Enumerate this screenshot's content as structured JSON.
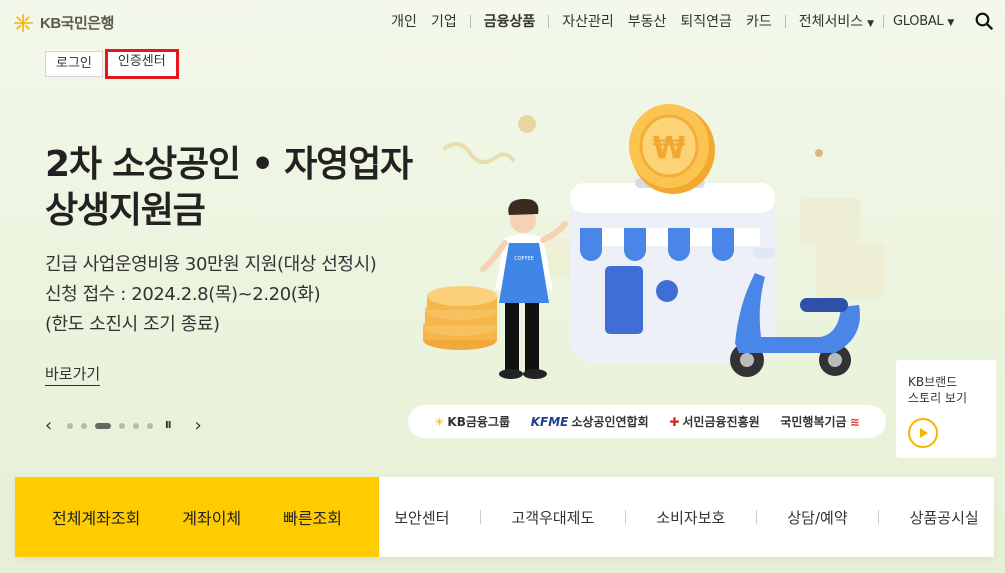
{
  "brand": {
    "logo_text": "KB국민은행",
    "logo_icon": "kb-star-icon"
  },
  "nav": {
    "items": [
      "개인",
      "기업",
      "금융상품",
      "자산관리",
      "부동산",
      "퇴직연금",
      "카드",
      "전체서비스",
      "GLOBAL"
    ],
    "search_icon": "search-icon"
  },
  "auth": {
    "login": "로그인",
    "cert_center": "인증센터"
  },
  "hero": {
    "title_line1": "2차 소상공인 • 자영업자",
    "title_line2": "상생지원금",
    "desc_line1": "긴급 사업운영비용 30만원 지원(대상 선정시)",
    "desc_line2": "신청 접수 : 2024.2.8(목)~2.20(화)",
    "desc_line3": "(한도 소진시 조기 종료)",
    "link": "바로가기",
    "apron_text": "COFFEE",
    "coin_symbol": "₩"
  },
  "carousel": {
    "prev": "‹",
    "next": "›",
    "pause": "II",
    "slide_count": 6,
    "active_index": 2
  },
  "partners": {
    "kb_group": "KB금융그룹",
    "kfme_mark": "KFME",
    "kfme": "소상공인연합회",
    "seomin": "서민금융진흥원",
    "kookmin": "국민행복기금"
  },
  "brand_story": {
    "line1": "KB브랜드",
    "line2": "스토리 보기"
  },
  "quick_menu": {
    "primary": [
      "전체계좌조회",
      "계좌이체",
      "빠른조회"
    ],
    "secondary": [
      "보안센터",
      "고객우대제도",
      "소비자보호",
      "상담/예약",
      "상품공시실"
    ]
  },
  "colors": {
    "accent": "#ffcc00",
    "highlight": "#e4181c",
    "hero_bg": "#eef5e2"
  }
}
